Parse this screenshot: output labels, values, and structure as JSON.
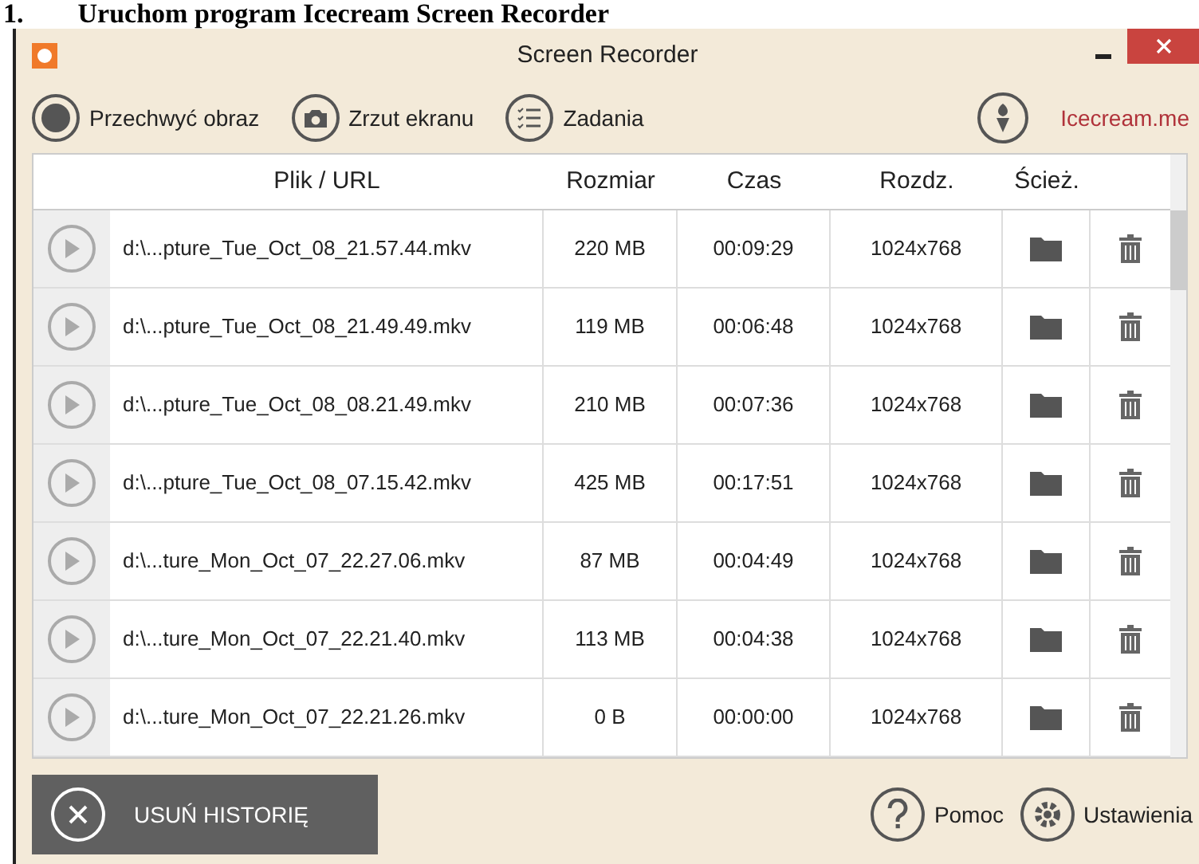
{
  "heading": "1.        Uruchom program Icecream Screen Recorder",
  "window": {
    "title": "Screen Recorder"
  },
  "toolbar": [
    {
      "label": "Przechwyć obraz",
      "kind": "record"
    },
    {
      "label": "Zrzut ekranu",
      "kind": "camera"
    },
    {
      "label": "Zadania",
      "kind": "tasks"
    }
  ],
  "brand_link": "Icecream.me",
  "table": {
    "columns": [
      "Plik / URL",
      "Rozmiar",
      "Czas",
      "Rozdz.",
      "Ścież."
    ],
    "rows": [
      {
        "file": "d:\\...pture_Tue_Oct_08_21.57.44.mkv",
        "size": "220 MB",
        "time": "00:09:29",
        "resolution": "1024x768"
      },
      {
        "file": "d:\\...pture_Tue_Oct_08_21.49.49.mkv",
        "size": "119 MB",
        "time": "00:06:48",
        "resolution": "1024x768"
      },
      {
        "file": "d:\\...pture_Tue_Oct_08_08.21.49.mkv",
        "size": "210 MB",
        "time": "00:07:36",
        "resolution": "1024x768"
      },
      {
        "file": "d:\\...pture_Tue_Oct_08_07.15.42.mkv",
        "size": "425 MB",
        "time": "00:17:51",
        "resolution": "1024x768"
      },
      {
        "file": "d:\\...ture_Mon_Oct_07_22.27.06.mkv",
        "size": "87 MB",
        "time": "00:04:49",
        "resolution": "1024x768"
      },
      {
        "file": "d:\\...ture_Mon_Oct_07_22.21.40.mkv",
        "size": "113 MB",
        "time": "00:04:38",
        "resolution": "1024x768"
      },
      {
        "file": "d:\\...ture_Mon_Oct_07_22.21.26.mkv",
        "size": "0 B",
        "time": "00:00:00",
        "resolution": "1024x768"
      }
    ]
  },
  "clear_history_button": "USUŃ HISTORIĘ",
  "footer": [
    {
      "label": "Pomoc",
      "kind": "help"
    },
    {
      "label": "Ustawienia",
      "kind": "settings"
    }
  ]
}
